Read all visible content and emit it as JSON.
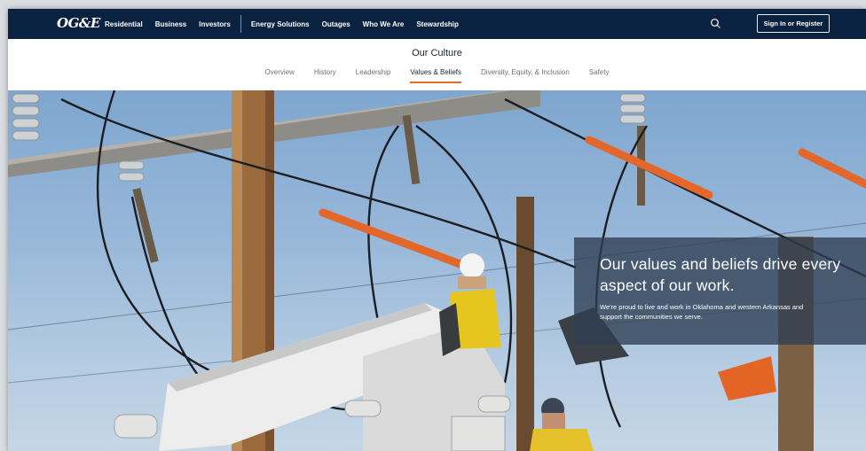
{
  "brand": {
    "logo_text": "OG&E"
  },
  "topnav": {
    "items": [
      "Residential",
      "Business",
      "Investors",
      "Energy Solutions",
      "Outages",
      "Who We Are",
      "Stewardship"
    ],
    "signin_label": "Sign In or Register",
    "search_icon": "search-icon"
  },
  "subnav": {
    "title": "Our Culture",
    "tabs": [
      "Overview",
      "History",
      "Leadership",
      "Values & Beliefs",
      "Diversity, Equity, & Inclusion",
      "Safety"
    ],
    "active_tab": "Values & Beliefs"
  },
  "hero": {
    "headline": "Our values and beliefs drive every aspect of our work.",
    "body": "We're proud to live and work in Oklahoma and western Arkansas and support the communities we serve."
  },
  "colors": {
    "nav_bg": "#0a2140",
    "accent": "#e06a28",
    "overlay": "#2e3e52"
  }
}
